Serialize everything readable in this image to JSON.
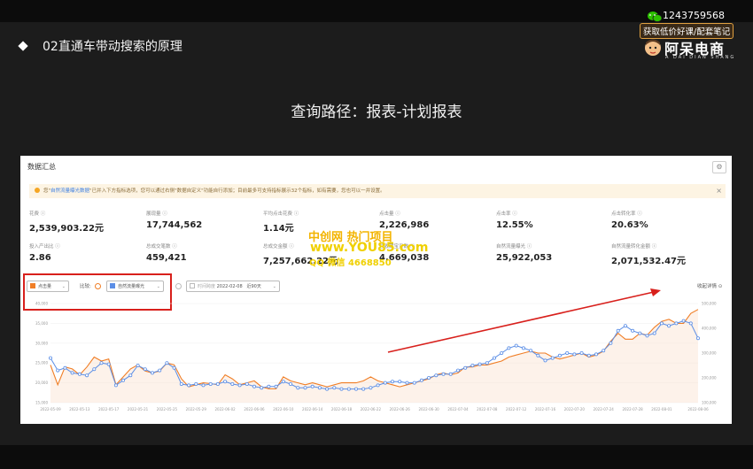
{
  "slide": {
    "title": "02直通车带动搜索的原理",
    "subtitle": "查询路径：报表-计划报表"
  },
  "brand": {
    "phone": "1243759568",
    "promo": "获取低价好课/配套笔记",
    "name": "阿呆电商",
    "pinyin": "A DAI DIAN SHANG"
  },
  "panel": {
    "title": "数据汇总",
    "notice_prefix": "您\"",
    "notice_highlight": "自然流量曝光数据",
    "notice_text": "\"已并入下方指标选项，您可以通过右侧\"数据自定义\"功能自行添加；目前最多可支持指标展示32个指标，如有需要，您也可以一并设置。",
    "metrics": [
      {
        "label": "花费 ⓘ",
        "value": "2,539,903.22元"
      },
      {
        "label": "展现量 ⓘ",
        "value": "17,744,562"
      },
      {
        "label": "平均点击花费 ⓘ",
        "value": "1.14元"
      },
      {
        "label": "点击量 ⓘ",
        "value": "2,226,986"
      },
      {
        "label": "点击率 ⓘ",
        "value": "12.55%"
      },
      {
        "label": "点击转化率 ⓘ",
        "value": "20.63%"
      },
      {
        "label": "投入产出比 ⓘ",
        "value": "2.86"
      },
      {
        "label": "总成交笔数 ⓘ",
        "value": "459,421"
      },
      {
        "label": "总成交金额 ⓘ",
        "value": "7,257,662.22元"
      },
      {
        "label": "总收藏宝贝数 ⓘ",
        "value": "4,669,038"
      },
      {
        "label": "自然流量曝光 ⓘ",
        "value": "25,922,053"
      },
      {
        "label": "自然流量转化金额 ⓘ",
        "value": "2,071,532.47元"
      }
    ],
    "filters": {
      "metric1": "点击量",
      "compare": "比较:",
      "metric2": "自然流量曝光",
      "time_label": "时间跨度",
      "date": "2022-02-08",
      "range": "近90天",
      "expand": "收起详情 ⊙"
    }
  },
  "watermark": {
    "line1": "中创网 热门项目",
    "line2": "www.YOU85.com",
    "line3": "QQ 微信 4668850"
  },
  "colors": {
    "click_series": "#f07e26",
    "exposure_series": "#5b8ee6",
    "annotation": "#d8201c"
  },
  "chart_data": {
    "type": "line",
    "x": [
      "2022-05-09",
      "2022-05-10",
      "2022-05-11",
      "2022-05-12",
      "2022-05-13",
      "2022-05-14",
      "2022-05-15",
      "2022-05-16",
      "2022-05-17",
      "2022-05-18",
      "2022-05-19",
      "2022-05-20",
      "2022-05-21",
      "2022-05-22",
      "2022-05-23",
      "2022-05-24",
      "2022-05-25",
      "2022-05-26",
      "2022-05-27",
      "2022-05-28",
      "2022-05-29",
      "2022-05-30",
      "2022-05-31",
      "2022-06-01",
      "2022-06-02",
      "2022-06-03",
      "2022-06-04",
      "2022-06-05",
      "2022-06-06",
      "2022-06-07",
      "2022-06-08",
      "2022-06-09",
      "2022-06-10",
      "2022-06-11",
      "2022-06-12",
      "2022-06-13",
      "2022-06-14",
      "2022-06-15",
      "2022-06-16",
      "2022-06-17",
      "2022-06-18",
      "2022-06-19",
      "2022-06-20",
      "2022-06-21",
      "2022-06-22",
      "2022-06-23",
      "2022-06-24",
      "2022-06-25",
      "2022-06-26",
      "2022-06-27",
      "2022-06-28",
      "2022-06-29",
      "2022-06-30",
      "2022-07-01",
      "2022-07-02",
      "2022-07-03",
      "2022-07-04",
      "2022-07-05",
      "2022-07-06",
      "2022-07-07",
      "2022-07-08",
      "2022-07-09",
      "2022-07-10",
      "2022-07-11",
      "2022-07-12",
      "2022-07-13",
      "2022-07-14",
      "2022-07-15",
      "2022-07-16",
      "2022-07-17",
      "2022-07-18",
      "2022-07-19",
      "2022-07-20",
      "2022-07-21",
      "2022-07-22",
      "2022-07-23",
      "2022-07-24",
      "2022-07-25",
      "2022-07-26",
      "2022-07-27",
      "2022-07-28",
      "2022-07-29",
      "2022-07-30",
      "2022-07-31",
      "2022-08-01",
      "2022-08-02",
      "2022-08-03",
      "2022-08-04",
      "2022-08-05",
      "2022-08-06"
    ],
    "x_ticks": [
      "2022-05-09",
      "2022-05-13",
      "2022-05-17",
      "2022-05-21",
      "2022-05-25",
      "2022-05-29",
      "2022-06-02",
      "2022-06-06",
      "2022-06-10",
      "2022-06-14",
      "2022-06-18",
      "2022-06-22",
      "2022-06-26",
      "2022-06-30",
      "2022-07-04",
      "2022-07-08",
      "2022-07-12",
      "2022-07-16",
      "2022-07-20",
      "2022-07-24",
      "2022-07-28",
      "2022-08-01",
      "2022-08-06"
    ],
    "left_ticks": [
      "40,000",
      "35,000",
      "30,000",
      "25,000",
      "20,000",
      "15,000"
    ],
    "right_ticks": [
      "500,000",
      "400,000",
      "300,000",
      "200,000",
      "100,000"
    ],
    "ylim_left": [
      15000,
      40000
    ],
    "ylim_right": [
      100000,
      500000
    ],
    "series": [
      {
        "name": "点击量",
        "axis": "left",
        "values": [
          24500,
          19500,
          24000,
          23500,
          22000,
          24000,
          26500,
          25500,
          26000,
          19500,
          21500,
          23500,
          24500,
          23000,
          22500,
          23000,
          25000,
          24500,
          21000,
          19000,
          19500,
          20000,
          19800,
          19500,
          22000,
          21000,
          19500,
          20000,
          20500,
          19000,
          18500,
          18500,
          21500,
          20500,
          20000,
          19500,
          20000,
          19500,
          19000,
          19500,
          20000,
          20000,
          20000,
          20500,
          21500,
          20500,
          20000,
          19500,
          19000,
          19500,
          20000,
          20500,
          21000,
          22000,
          22500,
          22000,
          22500,
          24000,
          24000,
          24500,
          24500,
          25000,
          25500,
          26500,
          27000,
          27500,
          28000,
          27500,
          27500,
          26500,
          26000,
          26500,
          27000,
          27500,
          26500,
          27000,
          28000,
          30500,
          32500,
          31000,
          31000,
          32500,
          32000,
          34000,
          35500,
          36000,
          35000,
          35000,
          37500,
          38500
        ]
      },
      {
        "name": "自然流量曝光",
        "axis": "right",
        "values": [
          280000,
          230000,
          240000,
          220000,
          215000,
          210000,
          235000,
          260000,
          255000,
          170000,
          190000,
          210000,
          250000,
          235000,
          220000,
          230000,
          260000,
          240000,
          175000,
          170000,
          175000,
          170000,
          175000,
          175000,
          185000,
          175000,
          170000,
          175000,
          165000,
          160000,
          165000,
          165000,
          185000,
          175000,
          160000,
          160000,
          165000,
          160000,
          155000,
          160000,
          155000,
          155000,
          155000,
          155000,
          160000,
          170000,
          180000,
          185000,
          185000,
          180000,
          180000,
          190000,
          200000,
          210000,
          215000,
          215000,
          230000,
          240000,
          250000,
          255000,
          260000,
          280000,
          300000,
          320000,
          330000,
          320000,
          310000,
          290000,
          270000,
          280000,
          290000,
          300000,
          295000,
          300000,
          290000,
          295000,
          310000,
          340000,
          390000,
          410000,
          390000,
          380000,
          370000,
          380000,
          420000,
          410000,
          420000,
          430000,
          420000,
          360000
        ]
      }
    ]
  }
}
